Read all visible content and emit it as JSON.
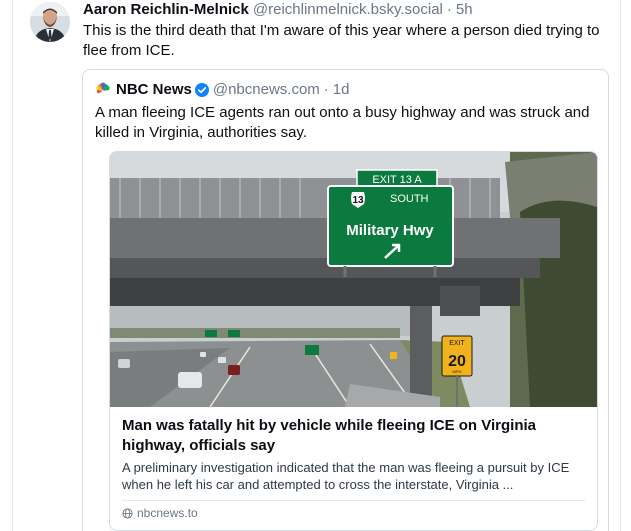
{
  "post": {
    "author": {
      "display_name": "Aaron Reichlin-Melnick",
      "handle": "@reichlinmelnick.bsky.social",
      "time": "5h"
    },
    "text": "This is the third death that I'm aware of this year where a person died trying to flee from ICE.",
    "separator": "·"
  },
  "quote": {
    "author": {
      "display_name": "NBC News",
      "handle": "@nbcnews.com",
      "time": "1d"
    },
    "text": "A man fleeing ICE agents ran out onto a busy highway and was struck and killed in Virginia, authorities say.",
    "link_card": {
      "title": "Man was fatally hit by vehicle while fleeing ICE on Virginia highway, officials say",
      "description": "A preliminary investigation indicated that the man was fleeing a pursuit by ICE when he left his car and attempted to cross the interstate, Virginia ...",
      "domain": "nbcnews.to",
      "image": {
        "exit_tab": "EXIT 13 A",
        "route_number": "13",
        "direction": "SOUTH",
        "destination": "Military Hwy",
        "exit_sign_top": "EXIT",
        "exit_sign_number": "20",
        "exit_sign_unit": "MPH"
      }
    }
  },
  "colors": {
    "text": "#0b0f14",
    "muted": "#6b7785",
    "border": "#d4dbe2",
    "verified": "#1083fe",
    "highway_sign_green": "#0b7a3e"
  }
}
